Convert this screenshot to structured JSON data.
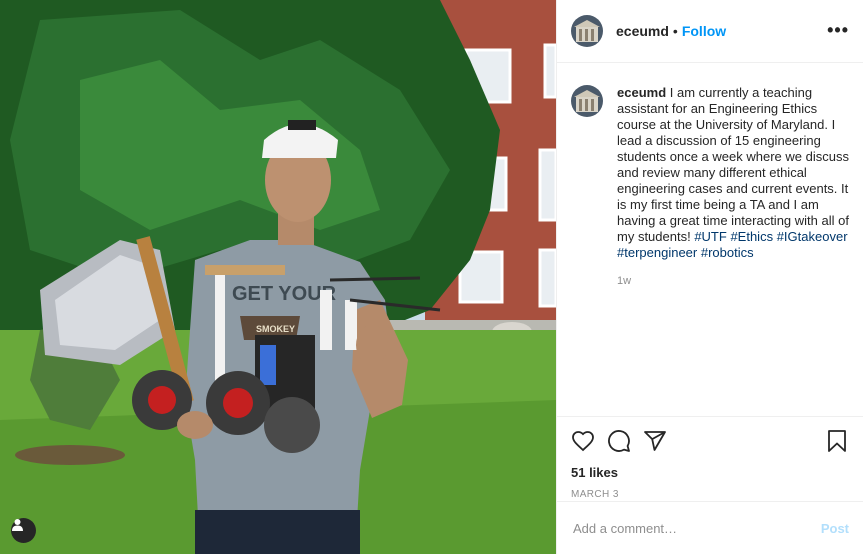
{
  "header": {
    "username": "eceumd",
    "separator": "•",
    "follow_label": "Follow",
    "more_label": "•••"
  },
  "caption": {
    "username": "eceumd",
    "text": " I am currently a teaching assistant for an Engineering Ethics course at the University of Maryland. I lead a discussion of 15 engineering students once a week where we discuss and review many different ethical engineering cases and current events. It is my first time being a TA and I am having a great time interacting with all of my students! ",
    "hashtags": [
      "#UTF",
      "#Ethics",
      "#IGtakeover",
      "#terpengineer",
      "#robotics"
    ],
    "time_ago": "1w"
  },
  "actions": {
    "likes": "51 likes",
    "date": "MARCH 3"
  },
  "comment": {
    "placeholder": "Add a comment…",
    "post_label": "Post"
  },
  "photo": {
    "shirt_text": "GET YOUR",
    "badge_text": "SMOKEY"
  },
  "colors": {
    "link": "#0095f6",
    "hashtag": "#00376b",
    "post_disabled": "#b2dffc",
    "muted": "#8e8e8e"
  }
}
